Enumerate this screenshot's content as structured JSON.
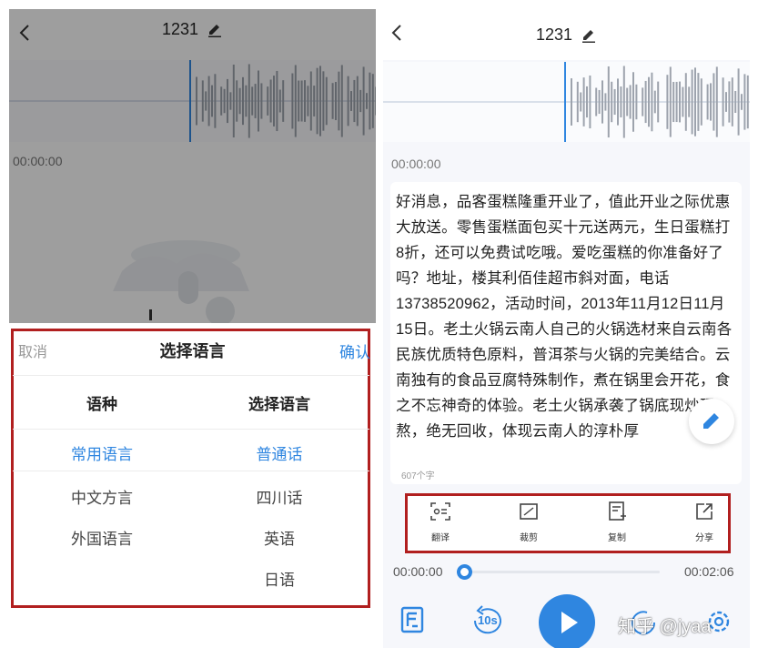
{
  "left": {
    "title": "1231",
    "time": "00:00:00",
    "sheet": {
      "cancel": "取消",
      "title": "选择语言",
      "confirm": "确认",
      "col_category": "语种",
      "col_language": "选择语言",
      "categories": [
        "常用语言",
        "中文方言",
        "外国语言"
      ],
      "languages": [
        "普通话",
        "四川话",
        "英语",
        "日语"
      ]
    }
  },
  "right": {
    "title": "1231",
    "time": "00:00:00",
    "transcript": "好消息，品客蛋糕隆重开业了，值此开业之际优惠大放送。零售蛋糕面包买十元送两元，生日蛋糕打8折，还可以免费试吃哦。爱吃蛋糕的你准备好了吗？地址，楼其利佰佳超市斜对面，电话13738520962，活动时间，2013年11月12日11月15日。老土火锅云南人自己的火锅选材来自云南各民族优质特色原料，普洱茶与火锅的完美结合。云南独有的食品豆腐特殊制作，煮在锅里会开花，食之不忘神奇的体验。老土火锅承袭了锅底现炒现熬，绝无回收，体现云南人的淳朴厚",
    "char_count": "607个字",
    "actions": [
      {
        "label": "翻译",
        "icon": "translate-icon"
      },
      {
        "label": "裁剪",
        "icon": "crop-icon"
      },
      {
        "label": "复制",
        "icon": "copy-icon"
      },
      {
        "label": "分享",
        "icon": "share-icon"
      }
    ],
    "player": {
      "current": "00:00:00",
      "total": "00:02:06",
      "progress": 0,
      "rewind_label": "10s"
    },
    "watermark": "知乎 @jyaa"
  },
  "colors": {
    "accent": "#2f86e0",
    "highlight_border": "#b11f1f",
    "waveform": "#9da3ad"
  }
}
